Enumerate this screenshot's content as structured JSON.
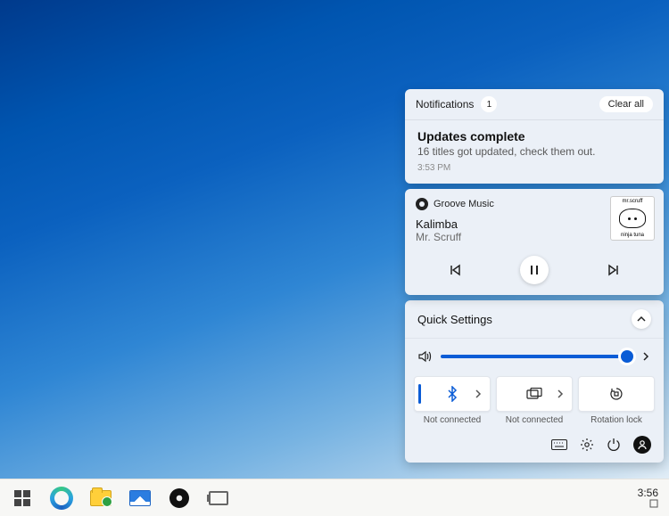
{
  "notifications": {
    "header_label": "Notifications",
    "count": "1",
    "clear_label": "Clear all",
    "item": {
      "title": "Updates complete",
      "body": "16 titles got updated, check them out.",
      "time": "3:53 PM"
    }
  },
  "media": {
    "app_name": "Groove Music",
    "track": "Kalimba",
    "artist": "Mr. Scruff",
    "album_top": "mr.scruff",
    "album_bottom": "ninja tuna"
  },
  "quick_settings": {
    "title": "Quick Settings",
    "volume_percent": 95,
    "tiles": [
      {
        "icon": "bluetooth-icon",
        "label": "Not connected",
        "expandable": true,
        "active": true
      },
      {
        "icon": "project-icon",
        "label": "Not connected",
        "expandable": true,
        "active": false
      },
      {
        "icon": "rotation-lock-icon",
        "label": "Rotation lock",
        "expandable": false,
        "active": false
      }
    ]
  },
  "taskbar": {
    "clock": "3:56"
  }
}
